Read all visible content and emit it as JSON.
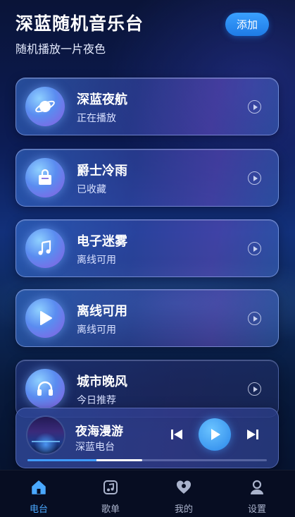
{
  "header": {
    "title": "深蓝随机音乐台",
    "subtitle": "随机播放一片夜色",
    "add_label": "添加"
  },
  "stations": [
    {
      "title": "深蓝夜航",
      "subtitle": "正在播放",
      "icon": "planet-icon"
    },
    {
      "title": "爵士冷雨",
      "subtitle": "已收藏",
      "icon": "bag-icon"
    },
    {
      "title": "电子迷雾",
      "subtitle": "离线可用",
      "icon": "music-note-icon"
    },
    {
      "title": "离线可用",
      "subtitle": "离线可用",
      "icon": "play-icon"
    },
    {
      "title": "城市晚风",
      "subtitle": "今日推荐",
      "icon": "headphones-icon"
    }
  ],
  "player": {
    "title": "夜海漫游",
    "subtitle": "深蓝电台",
    "progress": 0.48
  },
  "tabs": [
    {
      "label": "电台",
      "icon": "home-icon",
      "active": true
    },
    {
      "label": "歌单",
      "icon": "playlist-icon",
      "active": false
    },
    {
      "label": "我的",
      "icon": "heart-icon",
      "active": false
    },
    {
      "label": "设置",
      "icon": "user-icon",
      "active": false
    }
  ],
  "colors": {
    "accent": "#3f9cff",
    "tab_active": "#4aa8ff",
    "tab_inactive": "#aab3cc"
  }
}
